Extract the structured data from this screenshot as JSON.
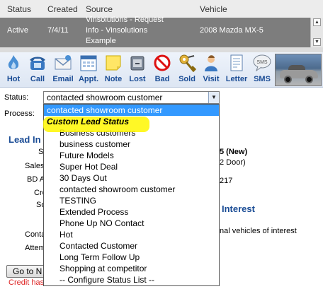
{
  "grid": {
    "headers": {
      "status": "Status",
      "created": "Created",
      "source": "Source",
      "vehicle": "Vehicle"
    },
    "row": {
      "status": "Active",
      "created": "7/4/11",
      "source_lines": [
        "Vinsolutions - Request",
        "Info - Vinsolutions",
        "Example"
      ],
      "vehicle": "2008 Mazda MX-5"
    }
  },
  "toolbar": {
    "items": [
      {
        "label": "Hot",
        "icon": "flame-icon"
      },
      {
        "label": "Call",
        "icon": "phone-icon"
      },
      {
        "label": "Email",
        "icon": "envelope-icon"
      },
      {
        "label": "Appt.",
        "icon": "calendar-icon"
      },
      {
        "label": "Note",
        "icon": "sticky-note-icon"
      },
      {
        "label": "Lost",
        "icon": "trash-icon"
      },
      {
        "label": "Bad",
        "icon": "no-sign-icon"
      },
      {
        "label": "Sold",
        "icon": "keys-icon"
      },
      {
        "label": "Visit",
        "icon": "person-icon"
      },
      {
        "label": "Letter",
        "icon": "letter-icon"
      },
      {
        "label": "SMS",
        "icon": "sms-bubble-icon"
      }
    ],
    "sms_bubble_text": "SMS"
  },
  "form": {
    "status_label": "Status:",
    "process_label": "Process:",
    "status_value": "contacted showroom customer"
  },
  "dropdown": {
    "selected": "contacted showroom customer",
    "group_label": "Custom Lead Status",
    "options": [
      "Business customers",
      "business customer",
      "Future Models",
      "Super Hot Deal",
      "30 Days Out",
      "contacted showroom customer",
      "TESTING",
      "Extended Process",
      "Phone Up NO Contact",
      "Hot",
      "Contacted Customer",
      "Long Term Follow Up",
      "Shopping at competitor",
      "-- Configure Status List --"
    ]
  },
  "background": {
    "lead_info": "Lead In",
    "left_labels": [
      "S",
      "Sales",
      "BD A",
      "Cre",
      "So",
      "Conta",
      "Attem"
    ],
    "right_fragments": [
      "5 (New)",
      "2 Door)",
      "217"
    ],
    "interest_title": "Interest",
    "interest_text": "nal vehicles of interest",
    "goto_button": "Go to N",
    "credit_text": "Credit has"
  },
  "colors": {
    "accent": "#1a4c95",
    "selection": "#3399ff",
    "highlight": "#fff700",
    "warning": "#d22222"
  }
}
